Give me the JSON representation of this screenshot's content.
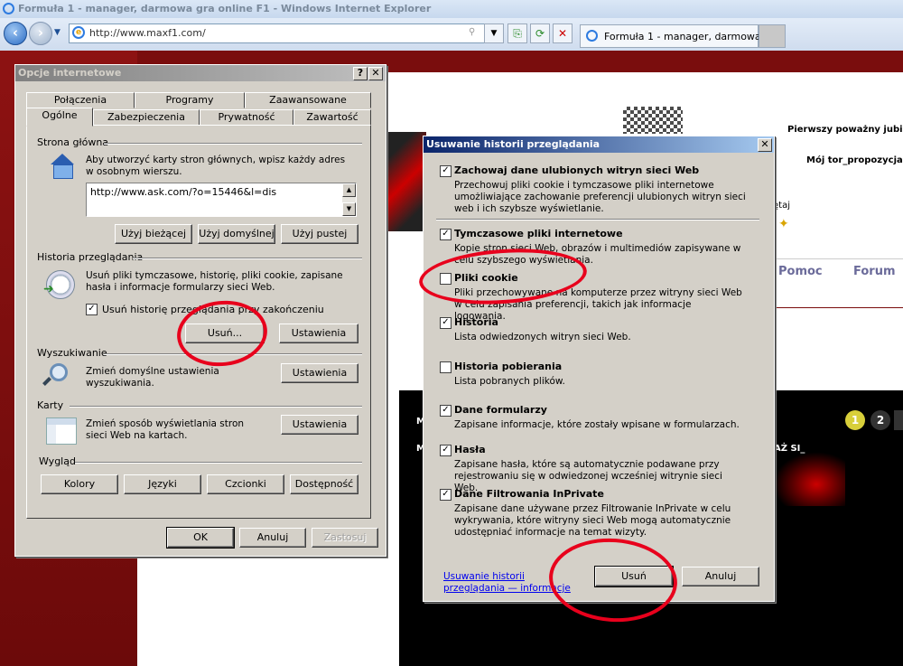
{
  "browser": {
    "title": "Formuła 1 - manager, darmowa gra online F1 - Windows Internet Explorer",
    "address": "http://www.maxf1.com/",
    "tab_label": "Formuła 1 - manager, darmowa ..."
  },
  "page": {
    "promo1": "Pierwszy poważny jubileu",
    "promo2": "Mój tor_propozycja n",
    "partial_word": "ętaj",
    "nav_help": "Pomoc",
    "nav_forum": "Forum",
    "pager_1": "1",
    "pager_2": "2",
    "side_m1": "M",
    "side_m2": "M",
    "az_si": "AŻ SI_"
  },
  "internet_options": {
    "title": "Opcje internetowe",
    "help_btn": "?",
    "close_btn": "✕",
    "tabs_row1": [
      "Połączenia",
      "Programy",
      "Zaawansowane"
    ],
    "tabs_row2": [
      "Ogólne",
      "Zabezpieczenia",
      "Prywatność",
      "Zawartość"
    ],
    "home": {
      "heading": "Strona główna",
      "desc": "Aby utworzyć karty stron głównych, wpisz każdy adres w osobnym wierszu.",
      "url": "http://www.ask.com/?o=15446&l=dis",
      "btn_current": "Użyj bieżącej",
      "btn_default": "Użyj domyślnej",
      "btn_blank": "Użyj pustej"
    },
    "history": {
      "heading": "Historia przeglądania",
      "desc": "Usuń pliki tymczasowe, historię, pliki cookie, zapisane hasła i informacje formularzy sieci Web.",
      "checkbox": "Usuń historię przeglądania przy zakończeniu",
      "checked": true,
      "btn_delete": "Usuń...",
      "btn_settings": "Ustawienia"
    },
    "search": {
      "heading": "Wyszukiwanie",
      "desc": "Zmień domyślne ustawienia wyszukiwania.",
      "btn_settings": "Ustawienia"
    },
    "tabs_section": {
      "heading": "Karty",
      "desc": "Zmień sposób wyświetlania stron sieci Web na kartach.",
      "btn_settings": "Ustawienia"
    },
    "appearance": {
      "heading": "Wygląd",
      "btn_colors": "Kolory",
      "btn_languages": "Języki",
      "btn_fonts": "Czcionki",
      "btn_accessibility": "Dostępność"
    },
    "footer": {
      "ok": "OK",
      "cancel": "Anuluj",
      "apply": "Zastosuj"
    }
  },
  "delete_history": {
    "title": "Usuwanie historii przeglądania",
    "close_btn": "✕",
    "items": [
      {
        "label": "Zachowaj dane ulubionych witryn sieci Web",
        "desc": "Przechowuj pliki cookie i tymczasowe pliki internetowe umożliwiające zachowanie preferencji ulubionych witryn sieci web i ich szybsze wyświetlanie.",
        "checked": true
      },
      {
        "label": "Tymczasowe pliki internetowe",
        "desc": "Kopie stron sieci Web, obrazów i multimediów zapisywane w celu szybszego wyświetlania.",
        "checked": true
      },
      {
        "label": "Pliki cookie",
        "desc": "Pliki przechowywane na komputerze przez witryny sieci Web w celu zapisania preferencji, takich jak informacje logowania.",
        "checked": false
      },
      {
        "label": "Historia",
        "desc": "Lista odwiedzonych witryn sieci Web.",
        "checked": true
      },
      {
        "label": "Historia pobierania",
        "desc": "Lista pobranych plików.",
        "checked": false
      },
      {
        "label": "Dane formularzy",
        "desc": "Zapisane informacje, które zostały wpisane w formularzach.",
        "checked": true
      },
      {
        "label": "Hasła",
        "desc": "Zapisane hasła, które są automatycznie podawane przy rejestrowaniu się w odwiedzonej wcześniej witrynie sieci Web.",
        "checked": true
      },
      {
        "label": "Dane Filtrowania InPrivate",
        "desc": "Zapisane dane używane przez Filtrowanie InPrivate w celu wykrywania, które witryny sieci Web mogą automatycznie udostępniać informacje na temat wizyty.",
        "checked": true
      }
    ],
    "link": "Usuwanie historii przeglądania — informacje",
    "btn_delete": "Usuń",
    "btn_cancel": "Anuluj"
  },
  "colors": {
    "accent_red": "#e8001c",
    "title_blue": "#0a246a",
    "dialog_gray": "#d4d0c8"
  }
}
